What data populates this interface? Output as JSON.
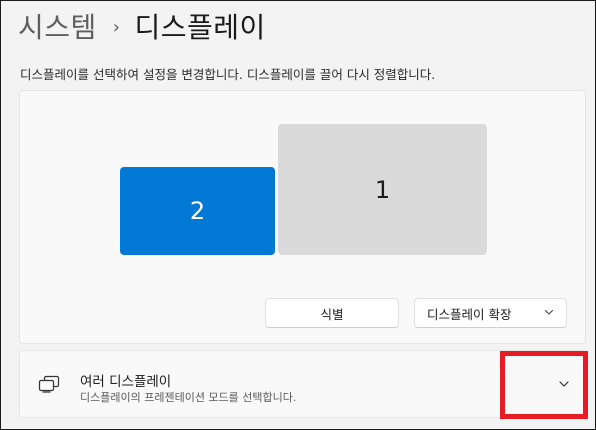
{
  "breadcrumb": {
    "parent": "시스템",
    "separator": "›",
    "current": "디스플레이"
  },
  "description": "디스플레이를 선택하여 설정을 변경합니다. 디스플레이를 끌어 다시 정렬합니다.",
  "arrangement": {
    "monitors": [
      {
        "label": "2",
        "selected": true
      },
      {
        "label": "1",
        "selected": false
      }
    ],
    "identify_label": "식별",
    "mode_select": {
      "value": "디스플레이 확장",
      "icon": "chevron-down-icon"
    }
  },
  "multiple_displays": {
    "icon": "multiple-displays-icon",
    "title": "여러 디스플레이",
    "subtitle": "디스플레이의 프레젠테이션 모드를 선택합니다.",
    "expand_icon": "chevron-down-icon",
    "expanded": false
  },
  "colors": {
    "accent": "#0078d4",
    "highlight": "#e61b23",
    "background": "#f3f3f3"
  }
}
